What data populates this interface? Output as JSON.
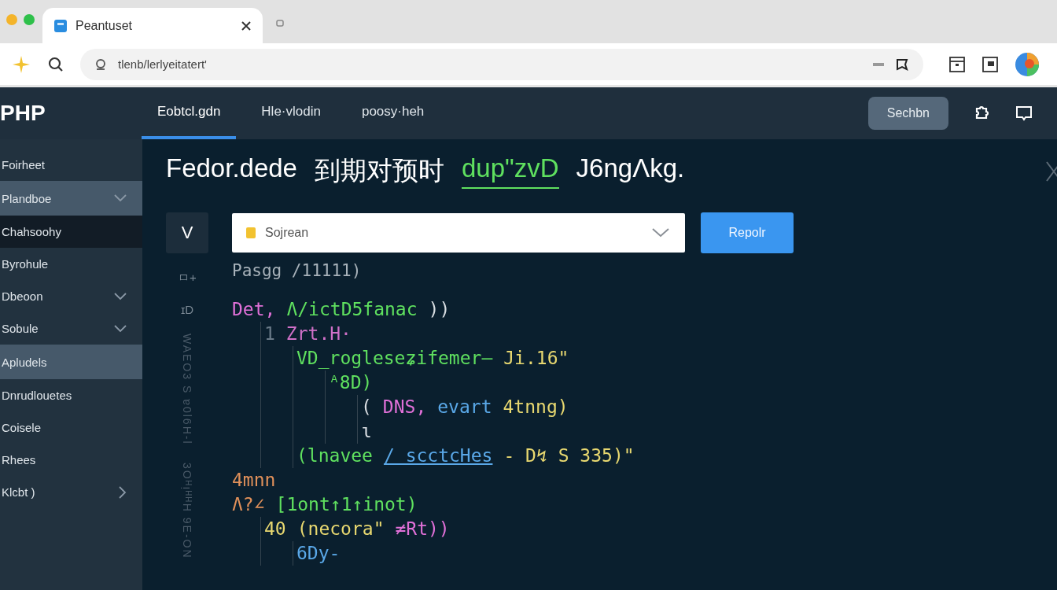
{
  "browser": {
    "tab": {
      "title": "Peantuset"
    },
    "url": "tlenb/lerlyeitatert'"
  },
  "header": {
    "logo": "PHP",
    "tabs": [
      {
        "label": "Eobtcl.gdn",
        "selected": true
      },
      {
        "label": "Hle·vlodin",
        "selected": false
      },
      {
        "label": "poosy·heh",
        "selected": false
      }
    ],
    "action": "Sechbn"
  },
  "sidebar": {
    "items": [
      {
        "label": "Foirheet",
        "selected": false,
        "active": false
      },
      {
        "label": "Plandboe",
        "selected": true,
        "active": false,
        "expanded": true
      },
      {
        "label": "Chahsoohy",
        "selected": false,
        "active": true
      },
      {
        "label": "Byrohule",
        "selected": false,
        "active": false
      },
      {
        "label": "Dbeoon",
        "selected": false,
        "active": false,
        "expanded": true
      },
      {
        "label": "Sobule",
        "selected": false,
        "active": false,
        "expanded": true
      },
      {
        "label": "Apludels",
        "selected": true,
        "active": false
      },
      {
        "label": "Dnrudlouetes",
        "selected": false,
        "active": false
      },
      {
        "label": "Coisele",
        "selected": false,
        "active": false
      },
      {
        "label": "Rhees",
        "selected": false,
        "active": false
      },
      {
        "label": "Klcbt )",
        "selected": false,
        "active": false,
        "expanded": false
      }
    ]
  },
  "main": {
    "title": [
      {
        "text": "Fedor.dede",
        "kind": "plain"
      },
      {
        "text": "到期对预时",
        "kind": "plain"
      },
      {
        "text": "dup\"zvD",
        "kind": "link"
      },
      {
        "text": "J6ngɅkg.",
        "kind": "plain"
      }
    ],
    "toggle": "V",
    "select": {
      "value": "Sojrean"
    },
    "button": "Repolr",
    "paging": "Pasgg /11111)",
    "gutter": [
      {
        "text": "ㅁ+",
        "kind": "mark"
      },
      {
        "text": "ɪD",
        "kind": "mark"
      },
      {
        "text": "WAEO3 S ɐ0l6H-l",
        "kind": "vertical"
      },
      {
        "text": "3OᴴᴉᴴᴴH 9E-ON",
        "kind": "vertical"
      }
    ],
    "code": [
      {
        "tokens": [
          {
            "text": "Det,",
            "color": "#e070d8"
          },
          {
            "text": "Ʌ/ictD5fanac",
            "color": "#5fe05f"
          },
          {
            "text": "))",
            "color": "#d8dde2"
          }
        ],
        "children": [
          {
            "tokens": [
              {
                "text": "1",
                "color": "#6a7a88"
              },
              {
                "text": "Zrt.H·",
                "color": "#d070c8"
              }
            ],
            "children": [
              {
                "tokens": [
                  {
                    "text": "VD_rogleseʑifemer—",
                    "color": "#5fe05f"
                  },
                  {
                    "text": "Ji.16\"",
                    "color": "#e8d870"
                  }
                ],
                "children": [
                  {
                    "tokens": [
                      {
                        "text": "ᴬ8D)",
                        "color": "#5fe05f"
                      }
                    ],
                    "children": [
                      {
                        "tokens": [
                          {
                            "text": "(",
                            "color": "#d8dde2"
                          },
                          {
                            "text": "DNS,",
                            "color": "#e070d8"
                          },
                          {
                            "text": "evart",
                            "color": "#5aa8e8"
                          },
                          {
                            "text": "4tnng)",
                            "color": "#e8d870"
                          }
                        ]
                      },
                      {
                        "tokens": [
                          {
                            "text": "ɩ",
                            "color": "#d8dde2"
                          }
                        ]
                      }
                    ]
                  }
                ]
              },
              {
                "tokens": [
                  {
                    "text": "(lnavee",
                    "color": "#5fe05f"
                  },
                  {
                    "text": "/ scctcHes",
                    "color": "#5aa8e8",
                    "underline": true
                  },
                  {
                    "text": "- D↯ S 335)\"",
                    "color": "#e8d870"
                  }
                ]
              }
            ]
          }
        ]
      },
      {
        "tokens": [
          {
            "text": "4mnn",
            "color": "#e0905a"
          }
        ]
      },
      {
        "tokens": [
          {
            "text": "Ʌ?∠",
            "color": "#e0905a"
          },
          {
            "text": "[1ont↑1↑inot)",
            "color": "#5fe05f"
          }
        ],
        "children": [
          {
            "tokens": [
              {
                "text": "40",
                "color": "#e8d870"
              },
              {
                "text": "(necora\"",
                "color": "#e8d870"
              },
              {
                "text": "≠Rt))",
                "color": "#e070d8"
              }
            ],
            "children": [
              {
                "tokens": [
                  {
                    "text": "6Dy-",
                    "color": "#5aa8e8"
                  }
                ]
              }
            ]
          }
        ]
      }
    ]
  }
}
